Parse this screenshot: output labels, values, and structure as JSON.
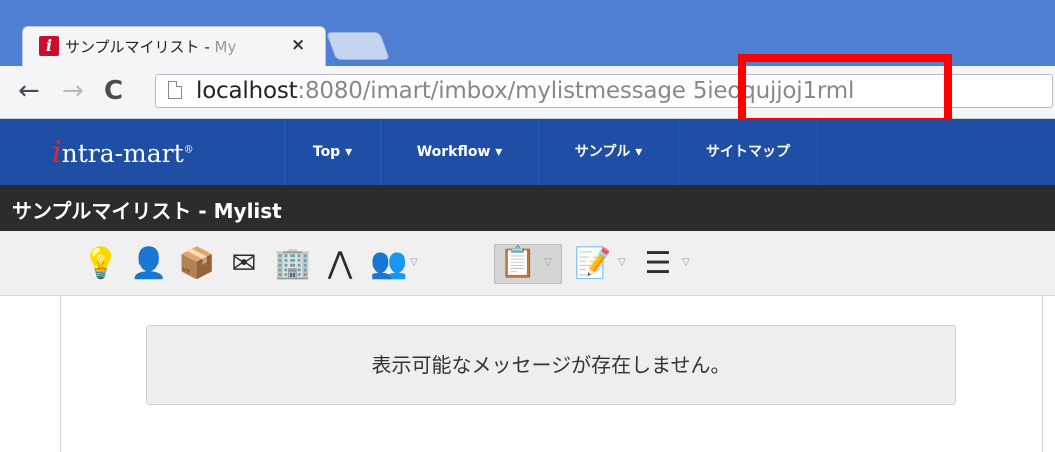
{
  "browser": {
    "tab": {
      "favicon_letter": "i",
      "title_visible": "サンプルマイリスト - ",
      "title_faded": "My",
      "close_glyph": "×"
    },
    "nav": {
      "back_glyph": "←",
      "forward_glyph": "→",
      "reload_glyph": "C"
    },
    "url": {
      "host": "localhost",
      "rest": ":8080/imart/imbox/mylistmessage",
      "separator": " ",
      "id": "5ieoqujjoj1rml"
    },
    "colors": {
      "tabstrip": "#4f7fd3",
      "highlight": "#ff0000"
    }
  },
  "app": {
    "logo": {
      "initial": "i",
      "text": "ntra-mart",
      "mark": "®"
    },
    "nav_items": [
      {
        "label": "Top ▾"
      },
      {
        "label": "Workflow ▾"
      },
      {
        "label": "サンプル ▾"
      },
      {
        "label": "サイトマップ"
      }
    ],
    "page_title": "サンプルマイリスト - Mylist",
    "toolbar_icons": [
      {
        "name": "lightbulb-icon",
        "glyph": "💡"
      },
      {
        "name": "person-icon",
        "glyph": "👤"
      },
      {
        "name": "box-icon",
        "glyph": "📦"
      },
      {
        "name": "mail-icon",
        "glyph": "✉"
      },
      {
        "name": "building-icon",
        "glyph": "🏢"
      },
      {
        "name": "compass-icon",
        "glyph": "⋀"
      },
      {
        "name": "group-icon",
        "glyph": "👥"
      },
      {
        "name": "checklist-icon",
        "glyph": "📋"
      },
      {
        "name": "document-arrow-icon",
        "glyph": "📝"
      },
      {
        "name": "list-icon",
        "glyph": "☰"
      }
    ],
    "message": "表示可能なメッセージが存在しません。",
    "colors": {
      "header": "#1f4fa5",
      "titlebar": "#2c2c2c"
    }
  }
}
